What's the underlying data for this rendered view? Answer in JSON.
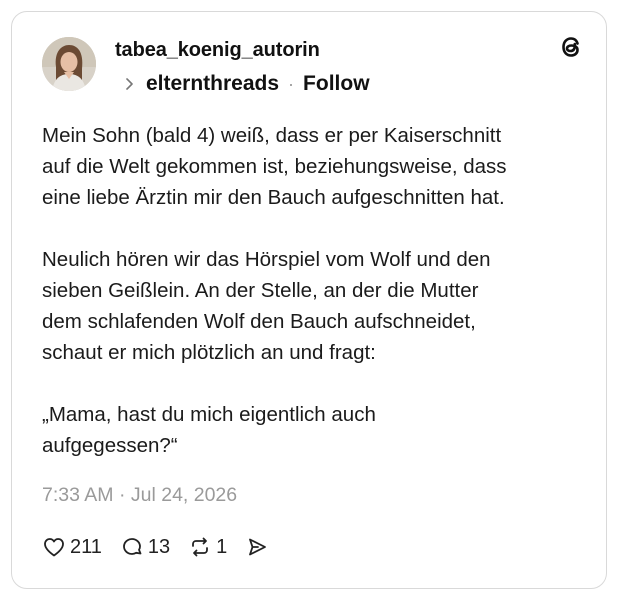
{
  "post": {
    "username": "tabea_koenig_autorin",
    "community": "elternthreads",
    "follow_label": "Follow",
    "separator": "·",
    "paragraphs": [
      "Mein Sohn (bald 4) weiß, dass er per Kaiserschnitt\nauf die Welt gekommen ist, beziehungsweise, dass\neine liebe Ärztin mir den Bauch aufgeschnitten hat.",
      "Neulich hören wir das Hörspiel vom Wolf und den\nsieben Geißlein. An der Stelle, an der die Mutter\ndem schlafenden Wolf den Bauch aufschneidet,\nschaut er mich plötzlich an und fragt:",
      "„Mama, hast du mich eigentlich auch\naufgegessen?“"
    ],
    "timestamp": "7:33 AM · Jul 24, 2026"
  },
  "actions": {
    "likes": "211",
    "replies": "13",
    "reposts": "1"
  },
  "icons": {
    "brand": "threads-logo-icon",
    "like": "heart-icon",
    "reply": "comment-bubble-icon",
    "repost": "repost-icon",
    "share": "send-icon",
    "chevron": "chevron-right-icon"
  },
  "colors": {
    "text": "#111111",
    "muted": "#9a9a9a",
    "border": "#d9d9d9"
  }
}
